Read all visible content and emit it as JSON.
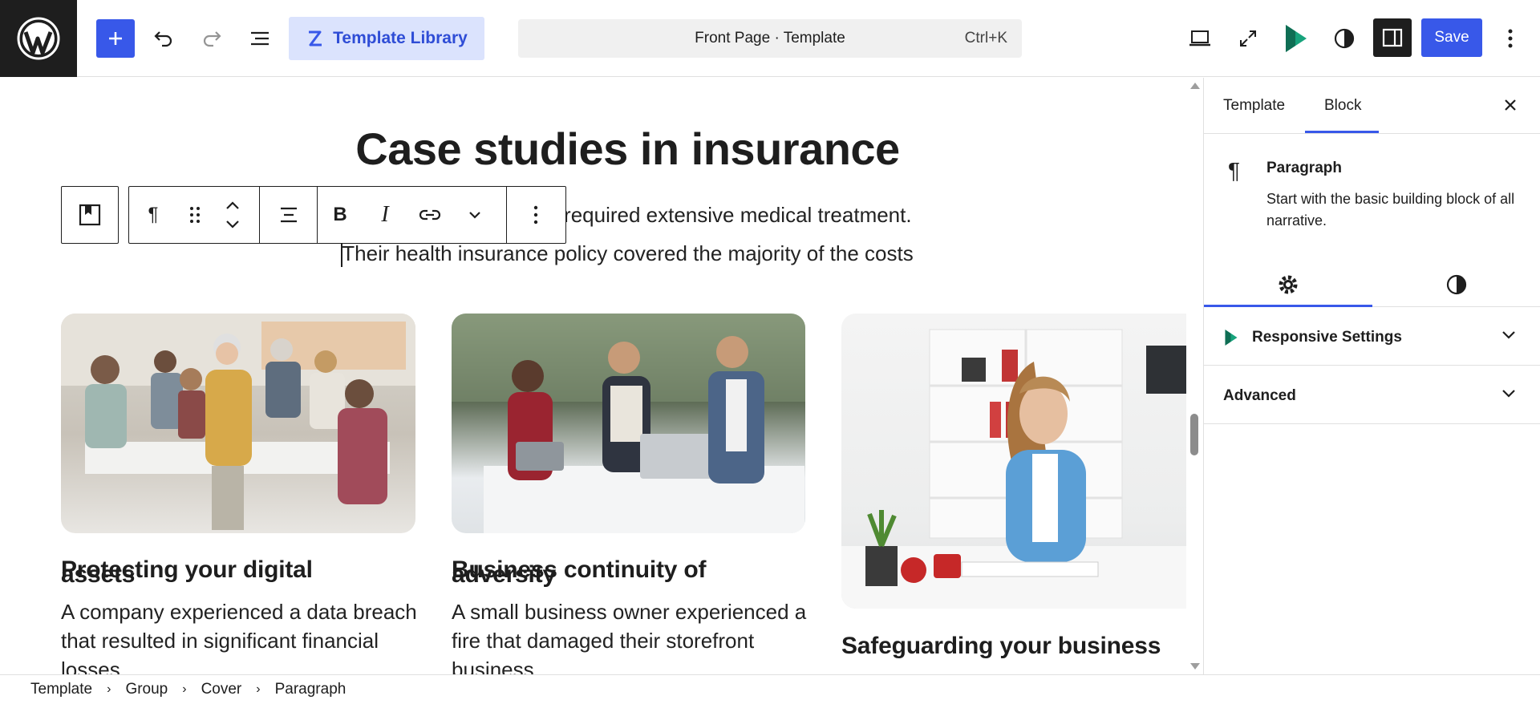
{
  "topbar": {
    "template_library_label": "Template Library",
    "command_title": "Front Page · Template",
    "command_shortcut": "Ctrl+K",
    "save_label": "Save"
  },
  "content": {
    "heading": "Case studies in insurance",
    "paragraph_line1": "alth issue that required extensive medical treatment.",
    "paragraph_line2": "Their health insurance policy covered the majority of the costs",
    "cards": [
      {
        "title": "Protecting your digital",
        "title_overlap": "assets",
        "text_lines": [
          "A company experienced a data breach",
          "that resulted in significant financial",
          "losses"
        ]
      },
      {
        "title": "Business continuity of",
        "title_overlap": "adversity",
        "text_lines": [
          "A small business owner experienced a",
          "fire that damaged their storefront",
          "business"
        ]
      },
      {
        "title": "Safeguarding your business",
        "text_lines": []
      }
    ]
  },
  "sidebar": {
    "tabs": [
      "Template",
      "Block"
    ],
    "active_tab": "Block",
    "block_name": "Paragraph",
    "block_description": "Start with the basic building block of all narrative.",
    "panels": [
      "Responsive Settings",
      "Advanced"
    ]
  },
  "breadcrumb": [
    "Template",
    "Group",
    "Cover",
    "Paragraph"
  ],
  "colors": {
    "accent": "#3858e9",
    "dark": "#1e1e1e",
    "tpl_bg": "#dbe3fd"
  }
}
